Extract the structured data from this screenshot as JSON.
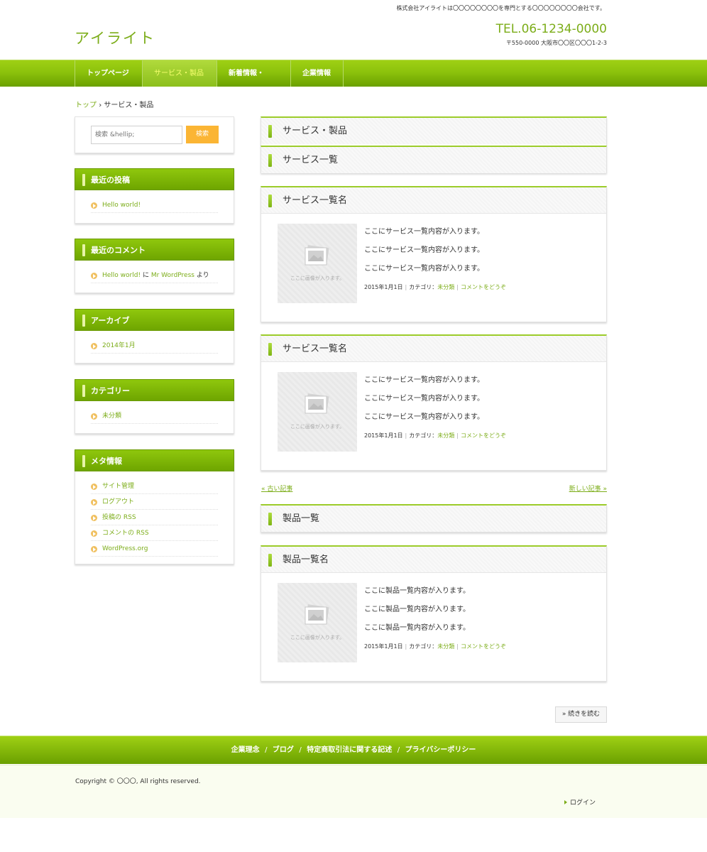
{
  "header": {
    "tagline": "株式会社アイライトは〇〇〇〇〇〇〇〇を専門とする〇〇〇〇〇〇〇〇会社です。",
    "logo": "アイライト",
    "tel": "TEL.06-1234-0000",
    "address": "〒550-0000 大阪市〇〇区〇〇〇1-2-3"
  },
  "nav": {
    "items": [
      {
        "label": "トップページ"
      },
      {
        "label": "サービス・製品",
        "active": true
      },
      {
        "label": "新着情報・FAQ"
      },
      {
        "label": "企業情報"
      }
    ]
  },
  "breadcrumb": {
    "home": "トップ",
    "separator": "›",
    "current": "サービス・製品"
  },
  "search": {
    "placeholder": "検索 &hellip;",
    "button": "検索"
  },
  "widgets": {
    "recent_posts": {
      "title": "最近の投稿",
      "items": [
        "Hello world!"
      ]
    },
    "recent_comments": {
      "title": "最近のコメント",
      "post": "Hello world!",
      "on": "に",
      "author": "Mr WordPress",
      "by": "より"
    },
    "archives": {
      "title": "アーカイブ",
      "items": [
        "2014年1月"
      ]
    },
    "categories": {
      "title": "カテゴリー",
      "items": [
        "未分類"
      ]
    },
    "meta": {
      "title": "メタ情報",
      "items": [
        "サイト管理",
        "ログアウト",
        "投稿の RSS",
        "コメントの RSS",
        "WordPress.org"
      ]
    }
  },
  "main": {
    "page_title": "サービス・製品",
    "service_section_title": "サービス一覧",
    "product_section_title": "製品一覧",
    "thumb_caption": "ここに画像が入ります。",
    "services": [
      {
        "title": "サービス一覧名",
        "lines": [
          "ここにサービス一覧内容が入ります。",
          "ここにサービス一覧内容が入ります。",
          "ここにサービス一覧内容が入ります。"
        ],
        "date": "2015年1月1日",
        "category_label": "カテゴリ：",
        "category": "未分類",
        "comment": "コメントをどうぞ"
      },
      {
        "title": "サービス一覧名",
        "lines": [
          "ここにサービス一覧内容が入ります。",
          "ここにサービス一覧内容が入ります。",
          "ここにサービス一覧内容が入ります。"
        ],
        "date": "2015年1月1日",
        "category_label": "カテゴリ：",
        "category": "未分類",
        "comment": "コメントをどうぞ"
      }
    ],
    "products": [
      {
        "title": "製品一覧名",
        "lines": [
          "ここに製品一覧内容が入ります。",
          "ここに製品一覧内容が入ります。",
          "ここに製品一覧内容が入ります。"
        ],
        "date": "2015年1月1日",
        "category_label": "カテゴリ：",
        "category": "未分類",
        "comment": "コメントをどうぞ"
      }
    ],
    "pager": {
      "older": "« 古い記事",
      "newer": "新しい記事 »"
    },
    "more_button": "» 続きを読む"
  },
  "footer": {
    "links": [
      "企業理念",
      "ブログ",
      "特定商取引法に関する記述",
      "プライバシーポリシー"
    ],
    "separator": "/",
    "copyright": "Copyright © 〇〇〇, All rights reserved.",
    "login": "ログイン"
  },
  "colors": {
    "accent": "#7cad19",
    "nav_green": "#8cc20c",
    "search_button": "#fbb534"
  }
}
